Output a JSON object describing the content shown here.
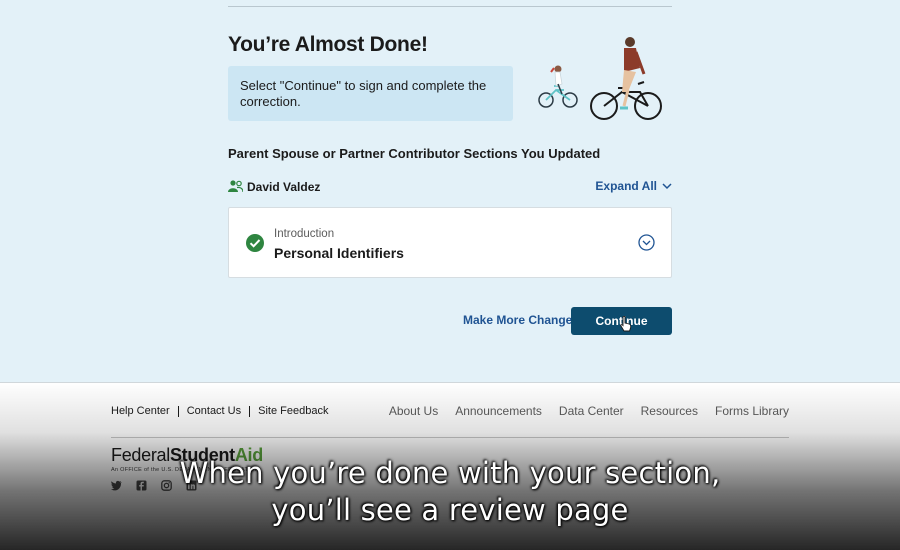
{
  "page": {
    "title": "You’re Almost Done!",
    "info_text": "Select \"Continue\" to sign and complete the correction."
  },
  "section": {
    "heading": "Parent Spouse or Partner Contributor Sections You Updated",
    "person_name": "David Valdez",
    "expand_all_label": "Expand All",
    "card": {
      "label": "Introduction",
      "title": "Personal Identifiers",
      "status": "complete"
    }
  },
  "actions": {
    "make_more_changes_label": "Make More Changes",
    "continue_label": "Continue"
  },
  "footer": {
    "left_links": [
      "Help Center",
      "Contact Us",
      "Site Feedback"
    ],
    "right_links": [
      "About Us",
      "Announcements",
      "Data Center",
      "Resources",
      "Forms Library"
    ],
    "logo": {
      "federal": "Federal",
      "student": "Student",
      "aid": "Aid",
      "subtitle": "An OFFICE of the U.S. DEPARTMENT of EDUCATION"
    },
    "social_icons": [
      "twitter-icon",
      "facebook-icon",
      "instagram-icon",
      "linkedin-icon"
    ]
  },
  "caption": {
    "line1": "When you’re done with your section,",
    "line2": "you’ll see a review page"
  },
  "colors": {
    "background": "#e3f1f8",
    "info_box": "#cce6f3",
    "accent_link": "#205493",
    "button": "#0d4c6e",
    "success": "#2e8540",
    "logo_aid": "#5aa23c"
  }
}
